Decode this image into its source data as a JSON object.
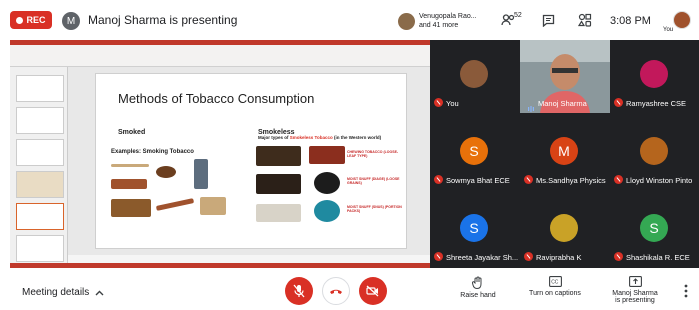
{
  "top_bar": {
    "rec_label": "REC",
    "presenter_initial": "M",
    "presenter_text": "Manoj Sharma is presenting",
    "people_chip": {
      "line1": "Venugopala Rao...",
      "line2": "and 41 more"
    },
    "participants_count": "52",
    "time": "3:08 PM",
    "self_label": "You"
  },
  "slide": {
    "title": "Methods of Tobacco Consumption",
    "smoked_header": "Smoked",
    "smokeless_header": "Smokeless",
    "examples_label": "Examples: Smoking Tobacco",
    "smokeless_sub_a": "Major types of ",
    "smokeless_sub_red": "Smokeless Tobacco",
    "smokeless_sub_b": " (in the Western world)",
    "snuff_labels": [
      "CHEWING TOBACCO (LOOSE-LEAF TYPE)",
      "MOIST SNUFF (DIAGE) (LOOSE GRAINS)",
      "MOIST SNUFF (SNUS) (PORTION PACKS)"
    ]
  },
  "participants": [
    {
      "name": "You",
      "initial": "",
      "color": "#8a5a3a",
      "photo": true
    },
    {
      "name": "Manoj Sharma",
      "initial": "",
      "color": "#7d8a8e",
      "video": true
    },
    {
      "name": "Ramyashree CSE",
      "initial": "",
      "color": "#c2185b",
      "photo": true
    },
    {
      "name": "Sowmya Bhat ECE",
      "initial": "S",
      "color": "#e8710a"
    },
    {
      "name": "Ms.Sandhya Physics",
      "initial": "M",
      "color": "#d84315"
    },
    {
      "name": "Lloyd Winston Pinto",
      "initial": "",
      "color": "#b5651d",
      "photo": true
    },
    {
      "name": "Shreeta Jayakar Sh...",
      "initial": "S",
      "color": "#1a73e8"
    },
    {
      "name": "Raviprabha K",
      "initial": "",
      "color": "#c9a227",
      "photo": true
    },
    {
      "name": "Shashikala R. ECE",
      "initial": "S",
      "color": "#34a853"
    }
  ],
  "bottom_bar": {
    "meeting_details": "Meeting details",
    "raise_hand": "Raise hand",
    "captions": "Turn on captions",
    "presenting_line1": "Manoj Sharma",
    "presenting_line2": "is presenting"
  },
  "colors": {
    "rec": "#d93025",
    "grid_bg": "#202124",
    "danger": "#d93025"
  }
}
